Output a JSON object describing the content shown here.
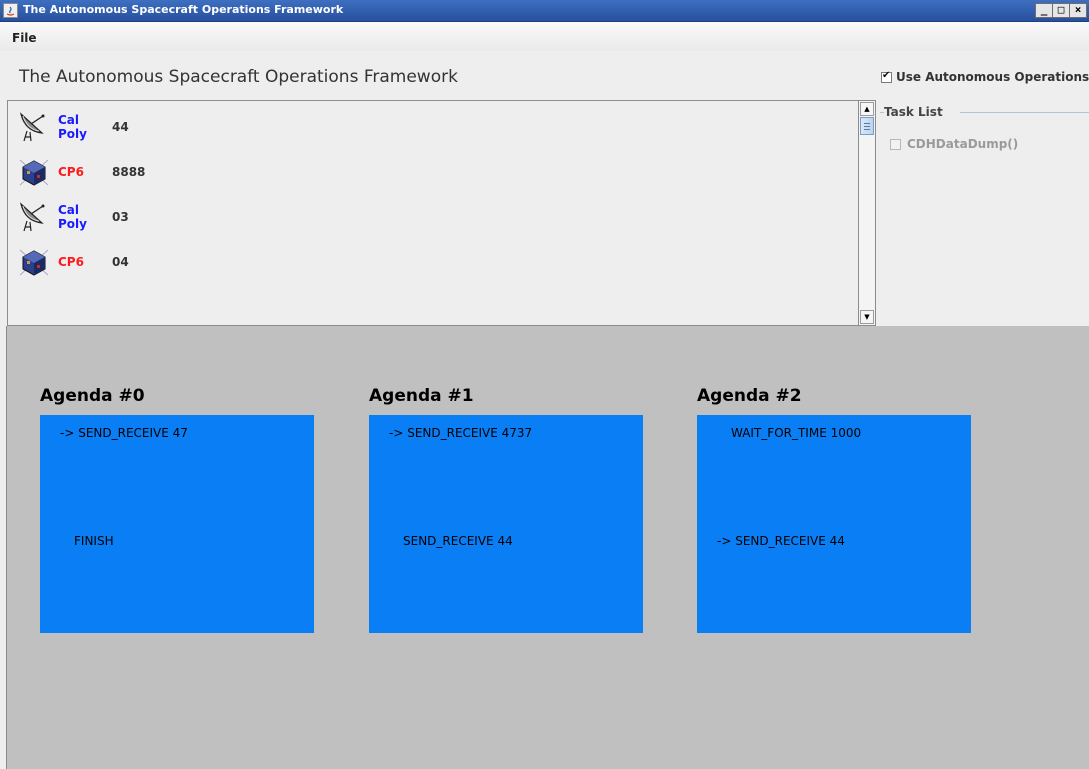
{
  "window": {
    "title": "The Autonomous Spacecraft Operations Framework",
    "buttons": {
      "minimize": "_",
      "maximize": "□",
      "close": "×"
    }
  },
  "menu": {
    "file": "File"
  },
  "header": {
    "title": "The Autonomous Spacecraft Operations Framework",
    "autonomous_checkbox": {
      "label": "Use Autonomous Operations",
      "checked": true
    }
  },
  "contacts": [
    {
      "icon": "ground-station-icon",
      "name": "Cal Poly",
      "value": "44",
      "color": "#1a1aff"
    },
    {
      "icon": "satellite-icon",
      "name": "CP6",
      "value": "8888",
      "color": "#ff1a1a"
    },
    {
      "icon": "ground-station-icon",
      "name": "Cal Poly",
      "value": "03",
      "color": "#1a1aff"
    },
    {
      "icon": "satellite-icon",
      "name": "CP6",
      "value": "04",
      "color": "#ff1a1a"
    }
  ],
  "task_list": {
    "title": "Task List",
    "items": [
      {
        "label": "CDHDataDump()",
        "checked": false,
        "enabled": false
      }
    ]
  },
  "agendas": [
    {
      "title": "Agenda #0",
      "items": [
        "-> SEND_RECEIVE 47",
        "FINISH"
      ]
    },
    {
      "title": "Agenda #1",
      "items": [
        "-> SEND_RECEIVE 4737",
        "SEND_RECEIVE 44"
      ]
    },
    {
      "title": "Agenda #2",
      "items": [
        "WAIT_FOR_TIME 1000",
        "-> SEND_RECEIVE 44"
      ]
    }
  ],
  "colors": {
    "agenda_box": "#0a7ff5",
    "agenda_background": "#c0c0c0",
    "title_bar": "#27509d"
  }
}
